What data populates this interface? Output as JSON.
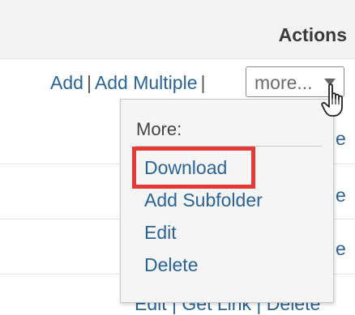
{
  "header": {
    "title": "Actions"
  },
  "row_actions": {
    "add": "Add",
    "separator": "|",
    "add_multiple": "Add Multiple"
  },
  "more_select": {
    "label": "more..."
  },
  "dropdown": {
    "header": "More:",
    "items": [
      "Download",
      "Add Subfolder",
      "Edit",
      "Delete"
    ],
    "highlighted_item": "Download",
    "highlight_color": "#e53935"
  },
  "background_rows": {
    "partial_e": "e",
    "bottom_row": "Edit | Get Link | Delete"
  },
  "colors": {
    "link": "#2a6496",
    "header_bg": "#f3f3f3",
    "menu_bg": "#f5f5f5"
  }
}
